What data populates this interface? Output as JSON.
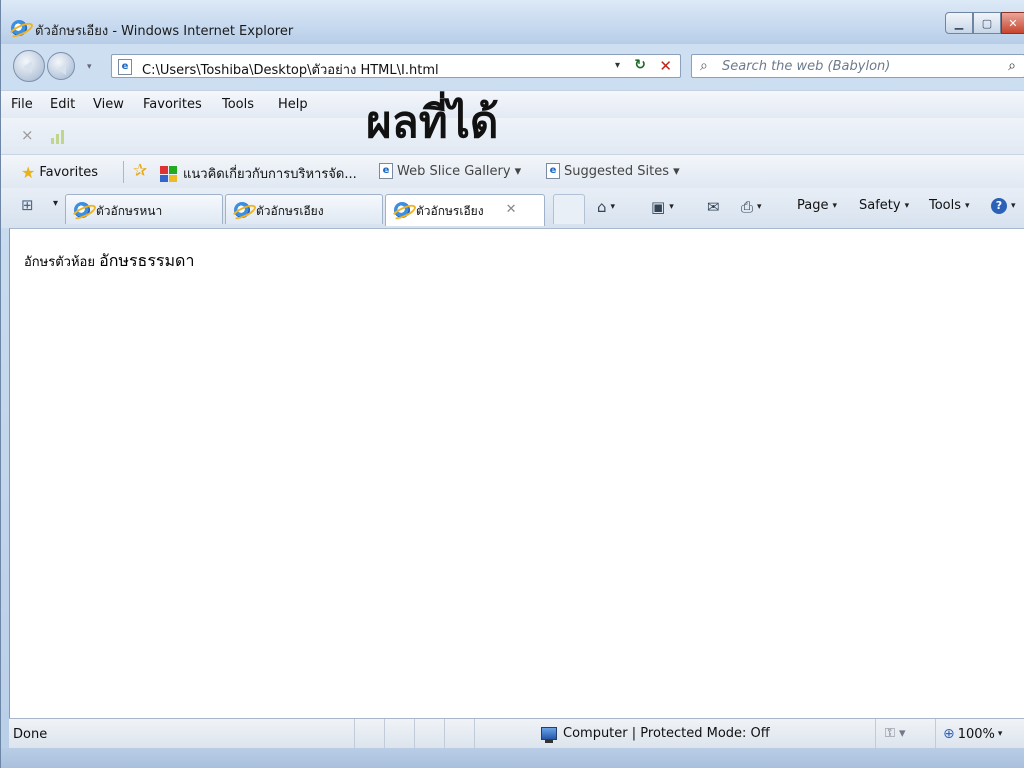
{
  "window": {
    "title": "ตัวอักษรเอียง - Windows Internet Explorer",
    "minimize_glyph": "▁",
    "maximize_glyph": "▢",
    "close_glyph": "✕"
  },
  "address_bar": {
    "url": "C:\\Users\\Toshiba\\Desktop\\ตัวอย่าง HTML\\I.html",
    "dropdown_glyph": "▾",
    "refresh_glyph": "↻",
    "stop_glyph": "✕"
  },
  "search": {
    "placeholder": "Search the web (Babylon)",
    "search_glyph": "⌕",
    "go_glyph": "⌕"
  },
  "menu": {
    "items": [
      "File",
      "Edit",
      "View",
      "Favorites",
      "Tools",
      "Help"
    ]
  },
  "overlay_caption": "ผลที่ได้",
  "loading": {
    "stop_glyph": "×"
  },
  "favorites_bar": {
    "favorites_label": "Favorites",
    "items": [
      {
        "label": "แนวคิดเกี่ยวกับการบริหารจัด...",
        "icon": "google-icon"
      },
      {
        "label": "Web Slice Gallery ▾",
        "icon": "ie-page-icon"
      },
      {
        "label": "Suggested Sites ▾",
        "icon": "ie-page-icon"
      }
    ]
  },
  "tabs": {
    "list_drop_glyph": "▾",
    "items": [
      {
        "label": "ตัวอักษรหนา",
        "active": false
      },
      {
        "label": "ตัวอักษรเอียง",
        "active": false
      },
      {
        "label": "ตัวอักษรเอียง",
        "active": true,
        "close_glyph": "✕"
      }
    ]
  },
  "command_bar": {
    "home_glyph": "⌂",
    "feeds_glyph": "▣",
    "mail_glyph": "✉",
    "print_glyph": "⎙",
    "page_label": "Page",
    "safety_label": "Safety",
    "tools_label": "Tools",
    "help_glyph": "?",
    "caret": "▾"
  },
  "content": {
    "small_text": "อักษรตัวห้อย",
    "normal_text": "อักษรธรรมดา"
  },
  "status_bar": {
    "status": "Done",
    "zone": "Computer | Protected Mode: Off",
    "security_glyph": "⚿ ▾",
    "zoom": "100%",
    "zoom_glyph": "⊕",
    "zoom_caret": "▾"
  },
  "colors": {
    "frame": "#b9cfe8",
    "accent": "#2b62b8",
    "content_bg": "#ffffff"
  }
}
